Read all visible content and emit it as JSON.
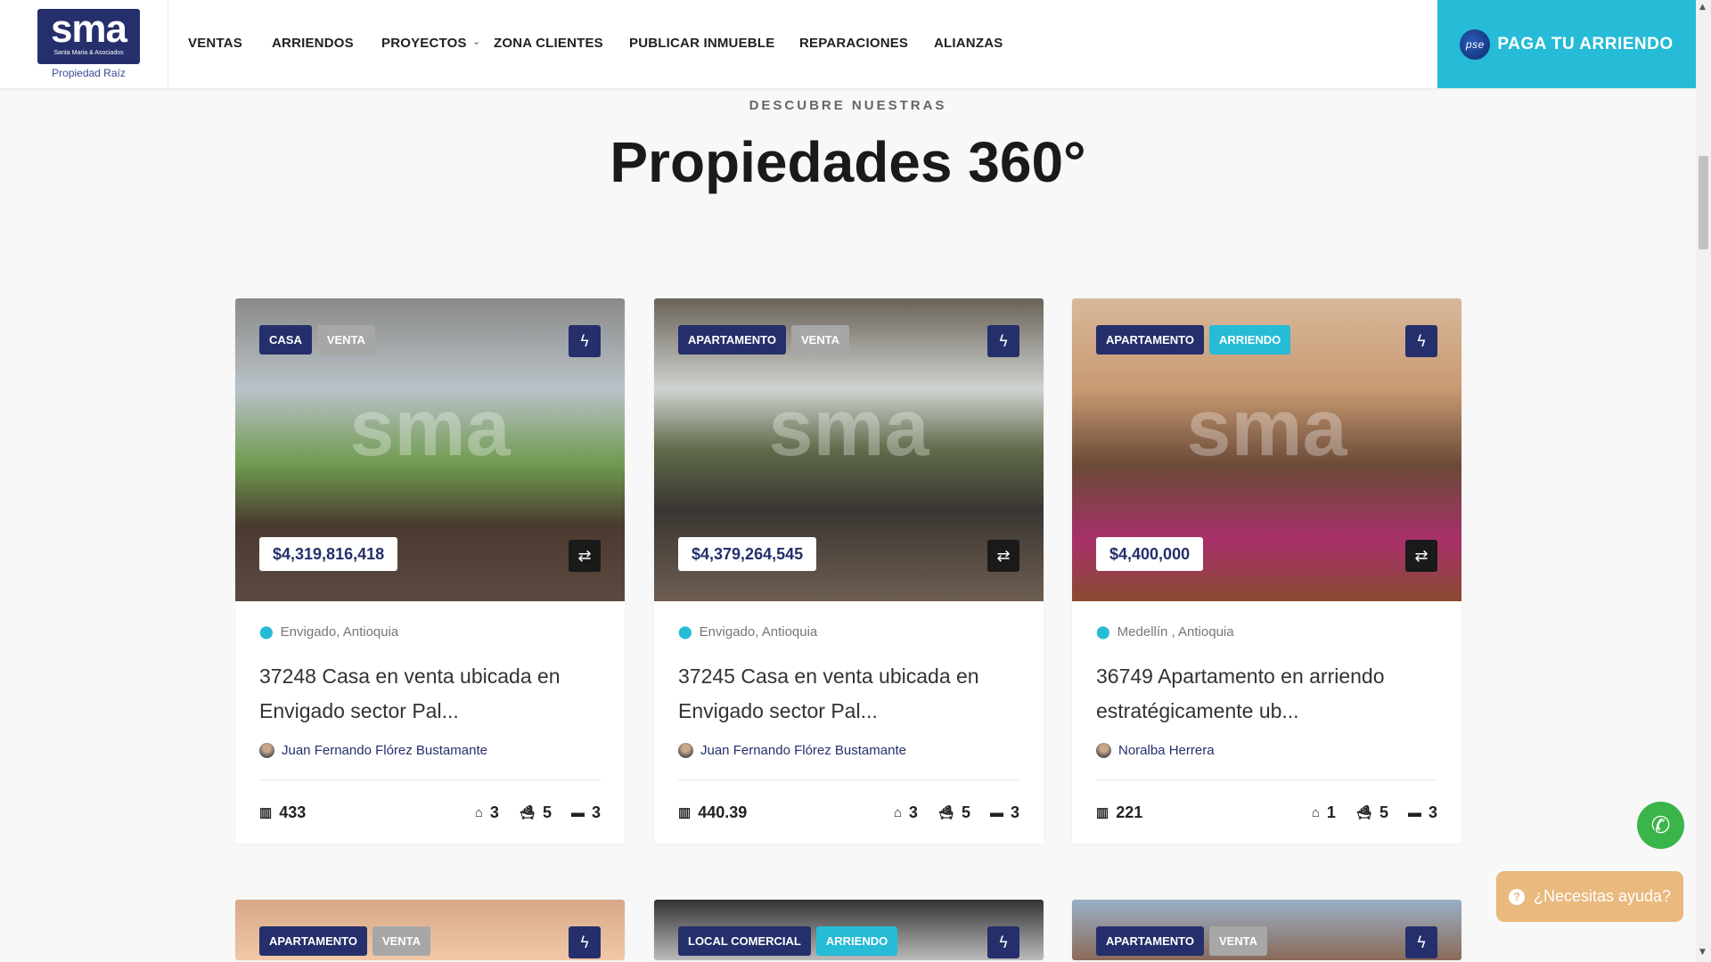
{
  "header": {
    "logo_text": "sma",
    "logo_subtext": "Santa Maria & Asociados",
    "logo_tagline": "Propiedad Raíz",
    "nav": [
      "VENTAS",
      "ARRIENDOS",
      "PROYECTOS",
      "ZONA CLIENTES",
      "PUBLICAR INMUEBLE",
      "REPARACIONES",
      "ALIANZAS"
    ],
    "pay_button": "PAGA TU ARRIENDO",
    "pse_label": "pse"
  },
  "section": {
    "eyebrow": "DESCUBRE NUESTRAS",
    "title": "Propiedades 360°"
  },
  "cards": [
    {
      "type": "CASA",
      "deal": "VENTA",
      "price": "$4,319,816,418",
      "location": "Envigado, Antioquia",
      "title_l1": "37248 Casa en venta ubicada en",
      "title_l2": "Envigado sector Pal...",
      "agent": "Juan Fernando Flórez Bustamante",
      "area": "433",
      "parking": "3",
      "baths": "5",
      "beds": "3"
    },
    {
      "type": "APARTAMENTO",
      "deal": "VENTA",
      "price": "$4,379,264,545",
      "location": "Envigado, Antioquia",
      "title_l1": "37245 Casa en venta ubicada en",
      "title_l2": "Envigado sector Pal...",
      "agent": "Juan Fernando Flórez Bustamante",
      "area": "440.39",
      "parking": "3",
      "baths": "5",
      "beds": "3"
    },
    {
      "type": "APARTAMENTO",
      "deal": "ARRIENDO",
      "price": "$4,400,000",
      "location": "Medellín , Antioquia",
      "title_l1": "36749 Apartamento en arriendo",
      "title_l2": "estratégicamente ub...",
      "agent": "Noralba Herrera",
      "area": "221",
      "parking": "1",
      "baths": "5",
      "beds": "3"
    }
  ],
  "cards_row2": [
    {
      "type": "APARTAMENTO",
      "deal": "VENTA"
    },
    {
      "type": "LOCAL COMERCIAL",
      "deal": "ARRIENDO"
    },
    {
      "type": "APARTAMENTO",
      "deal": "VENTA"
    }
  ],
  "help_button": "¿Necesitas ayuda?",
  "colors": {
    "primary": "#252f6b",
    "accent": "#26bbd6",
    "venta": "#a7a7a7",
    "help": "#e9b97d",
    "whatsapp": "#3ab54a"
  }
}
